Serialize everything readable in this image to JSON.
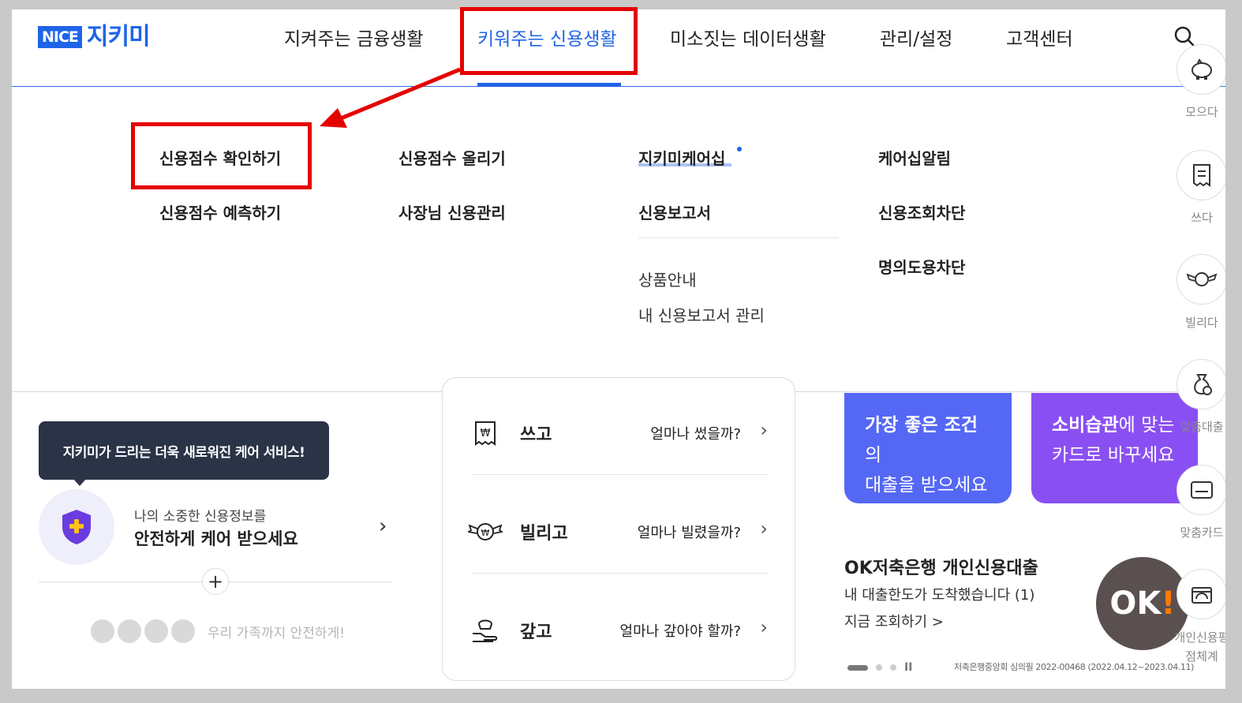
{
  "header": {
    "logo_nice": "NICE",
    "logo_name": "지키미",
    "nav": [
      {
        "label": "지켜주는 금융생활"
      },
      {
        "label": "키워주는 신용생활"
      },
      {
        "label": "미소짓는 데이터생활"
      },
      {
        "label": "관리/설정"
      },
      {
        "label": "고객센터"
      }
    ],
    "active_nav_index": 1,
    "accent": "#1f64e8"
  },
  "dropdown": {
    "col1": [
      "신용점수 확인하기",
      "신용점수 예측하기"
    ],
    "col2": [
      "신용점수 올리기",
      "사장님 신용관리"
    ],
    "col3": [
      "지키미케어십",
      "신용보고서"
    ],
    "col3_sub": [
      "상품안내",
      "내 신용보고서 관리"
    ],
    "col4": [
      "케어십알림",
      "신용조회차단",
      "명의도용차단"
    ]
  },
  "care": {
    "tooltip": "지키미가 드리는 더욱 새로워진 케어 서비스!",
    "line1": "나의 소중한 신용정보를",
    "line2": "안전하게 케어 받으세요",
    "family_text": "우리 가족까지 안전하게!"
  },
  "summary": {
    "rows": [
      {
        "title": "쓰고",
        "question": "얼마나 썼을까?"
      },
      {
        "title": "빌리고",
        "question": "얼마나 빌렸을까?"
      },
      {
        "title": "갚고",
        "question": "얼마나 갚아야 할까?"
      }
    ]
  },
  "promos": [
    {
      "strong": "가장 좋은 조건",
      "rest1": "의",
      "line2": "대출을 받으세요",
      "color": "#5468f5"
    },
    {
      "strong": "소비습관",
      "rest1": "에 맞는",
      "line2": "카드로 바꾸세요",
      "color": "#8a4ff2"
    }
  ],
  "ad": {
    "title": "OK저축은행 개인신용대출",
    "line1": "내 대출한도가 도착했습니다 (1)",
    "line2": "지금 조회하기 >",
    "logo": "OK",
    "legal": "저축은행중앙회 심의필 2022-00468 (2022.04.12~2023.04.11)"
  },
  "quick_menu": [
    {
      "label": "모으다",
      "icon": "piggy-bank-icon"
    },
    {
      "label": "쓰다",
      "icon": "receipt-icon"
    },
    {
      "label": "빌리다",
      "icon": "winged-coin-icon"
    },
    {
      "label": "맞춤대출",
      "icon": "money-bag-icon"
    },
    {
      "label": "맞춤카드",
      "icon": "card-icon"
    },
    {
      "label": "개인신용평점체계",
      "icon": "scale-icon"
    }
  ],
  "annotation_color": "#e50000"
}
